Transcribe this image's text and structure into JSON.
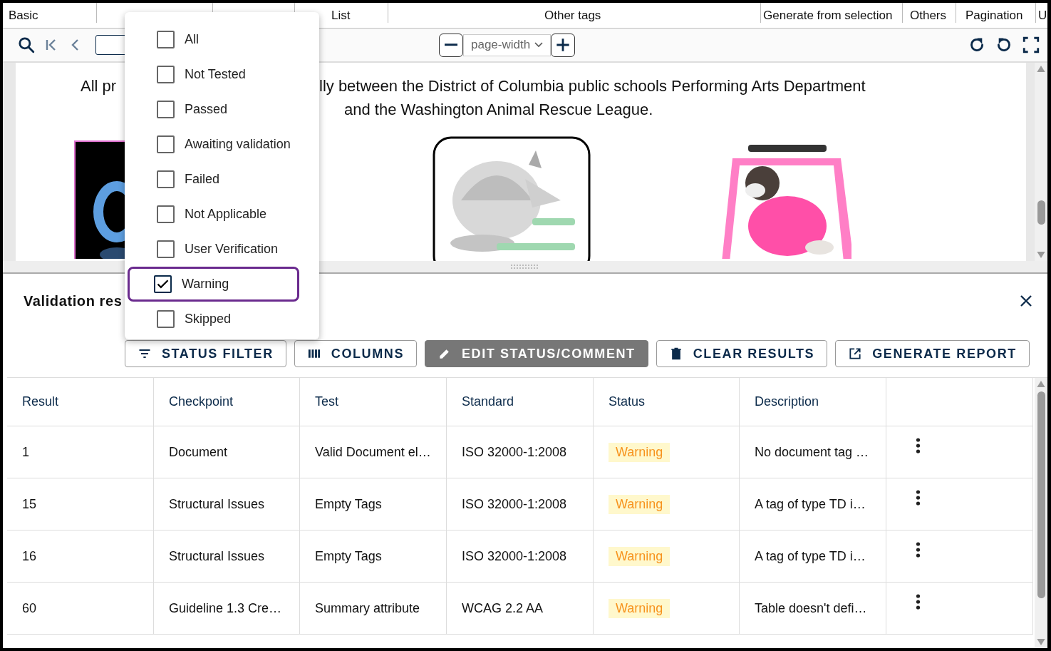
{
  "tabs": [
    {
      "label": "Basic"
    },
    {
      "label": "List"
    },
    {
      "label": "Other tags"
    },
    {
      "label": "Generate from selection"
    },
    {
      "label": "Others"
    },
    {
      "label": "Pagination"
    },
    {
      "label": "U"
    }
  ],
  "toolbar": {
    "zoom": "page-width"
  },
  "document": {
    "lines": [
      {
        "parts": [
          "All pr",
          "lly between the District of Columbia public schools Performing Arts Department"
        ]
      },
      {
        "parts": [
          "and the Washington Animal Rescue League."
        ]
      }
    ]
  },
  "panel": {
    "title": "Validation res",
    "buttons": [
      {
        "label": "STATUS FILTER",
        "kind": "outlined"
      },
      {
        "label": "COLUMNS",
        "kind": "outlined"
      },
      {
        "label": "EDIT STATUS/COMMENT",
        "kind": "contained"
      },
      {
        "label": "CLEAR RESULTS",
        "kind": "outlined"
      },
      {
        "label": "GENERATE REPORT",
        "kind": "outlined"
      }
    ]
  },
  "status_filter": {
    "options": [
      {
        "label": "All",
        "checked": false,
        "focused": false
      },
      {
        "label": "Not Tested",
        "checked": false,
        "focused": false
      },
      {
        "label": "Passed",
        "checked": false,
        "focused": false
      },
      {
        "label": "Awaiting validation",
        "checked": false,
        "focused": false
      },
      {
        "label": "Failed",
        "checked": false,
        "focused": false
      },
      {
        "label": "Not Applicable",
        "checked": false,
        "focused": false
      },
      {
        "label": "User Verification",
        "checked": false,
        "focused": false
      },
      {
        "label": "Warning",
        "checked": true,
        "focused": true
      },
      {
        "label": "Skipped",
        "checked": false,
        "focused": false
      }
    ]
  },
  "table": {
    "columns": [
      "Result",
      "Checkpoint",
      "Test",
      "Standard",
      "Status",
      "Description"
    ],
    "rows": [
      {
        "cells": [
          "1",
          "Document",
          "Valid Document el…",
          "ISO 32000-1:2008"
        ],
        "status": {
          "label": "Warning",
          "kind": "warning"
        },
        "description": "No document tag …"
      },
      {
        "cells": [
          "15",
          "Structural Issues",
          "Empty Tags",
          "ISO 32000-1:2008"
        ],
        "status": {
          "label": "Warning",
          "kind": "warning"
        },
        "description": "A tag of type TD i…"
      },
      {
        "cells": [
          "16",
          "Structural Issues",
          "Empty Tags",
          "ISO 32000-1:2008"
        ],
        "status": {
          "label": "Warning",
          "kind": "warning"
        },
        "description": "A tag of type TD i…"
      },
      {
        "cells": [
          "60",
          "Guideline 1.3 Cre…",
          "Summary attribute",
          "WCAG 2.2 AA"
        ],
        "status": {
          "label": "Warning",
          "kind": "warning"
        },
        "description": "Table doesn't defi…"
      }
    ]
  }
}
